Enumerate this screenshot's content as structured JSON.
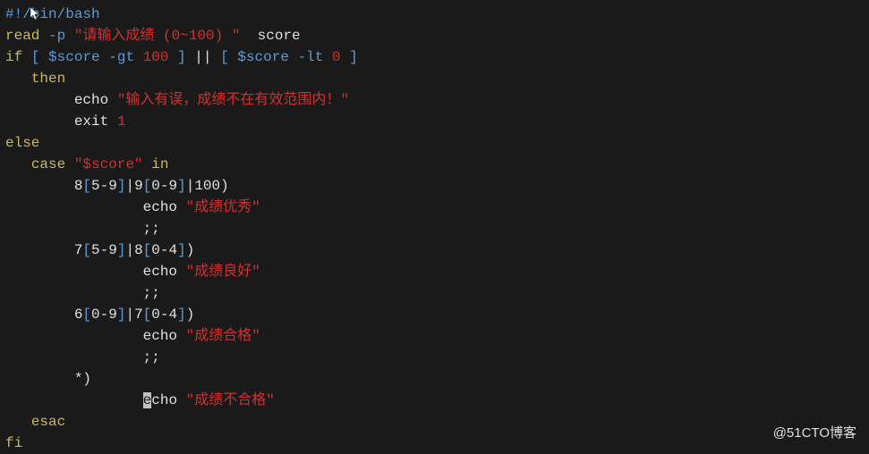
{
  "shebang": "#!/bin/bash",
  "l2": {
    "kw": "read",
    "flag": " -p ",
    "str": "\"请输入成绩 (0~100) \"",
    "rest": "  score"
  },
  "l3": {
    "kw": "if",
    "sp1": " ",
    "b1": "[",
    "sp2": " ",
    "v1": "$score",
    "sp3": " ",
    "f1": "-gt",
    "sp4": " ",
    "n1": "100",
    "sp5": " ",
    "b2": "]",
    "pipe": " || ",
    "b3": "[",
    "sp6": " ",
    "v2": "$score",
    "sp7": " ",
    "f2": "-lt",
    "sp8": " ",
    "n2": "0",
    "sp9": " ",
    "b4": "]"
  },
  "l4": {
    "ind": "   ",
    "kw": "then"
  },
  "l5": {
    "ind": "        ",
    "cmd": "echo ",
    "str": "\"输入有误，成绩不在有效范围内！\""
  },
  "l6": {
    "ind": "        ",
    "cmd": "exit ",
    "n": "1"
  },
  "l7": {
    "kw": "else"
  },
  "l8": {
    "ind": "   ",
    "kw": "case",
    "sp": " ",
    "str": "\"$score\"",
    "sp2": " ",
    "kw2": "in"
  },
  "l9": {
    "ind": "        ",
    "t1": "8",
    "b1": "[",
    "r1": "5-9",
    "b2": "]",
    "p1": "|",
    "t2": "9",
    "b3": "[",
    "r2": "0-9",
    "b4": "]",
    "p2": "|",
    "t3": "100",
    "paren": ")"
  },
  "l10": {
    "ind": "                ",
    "cmd": "echo ",
    "str": "\"成绩优秀\""
  },
  "l11": {
    "ind": "                ",
    "semi": ";;"
  },
  "l12": {
    "ind": "        ",
    "t1": "7",
    "b1": "[",
    "r1": "5-9",
    "b2": "]",
    "p1": "|",
    "t2": "8",
    "b3": "[",
    "r2": "0-4",
    "b4": "]",
    "paren": ")"
  },
  "l13": {
    "ind": "                ",
    "cmd": "echo ",
    "str": "\"成绩良好\""
  },
  "l14": {
    "ind": "                ",
    "semi": ";;"
  },
  "l15": {
    "ind": "        ",
    "t1": "6",
    "b1": "[",
    "r1": "0-9",
    "b2": "]",
    "p1": "|",
    "t2": "7",
    "b3": "[",
    "r2": "0-4",
    "b4": "]",
    "paren": ")"
  },
  "l16": {
    "ind": "                ",
    "cmd": "echo ",
    "str": "\"成绩合格\""
  },
  "l17": {
    "ind": "                ",
    "semi": ";;"
  },
  "l18": {
    "ind": "        ",
    "star": "*",
    "paren": ")"
  },
  "l19": {
    "ind": "                ",
    "cur": "e",
    "rest": "cho ",
    "str": "\"成绩不合格\""
  },
  "l20": {
    "ind": "   ",
    "kw": "esac"
  },
  "l21": {
    "kw": "fi"
  },
  "watermark": "@51CTO博客"
}
